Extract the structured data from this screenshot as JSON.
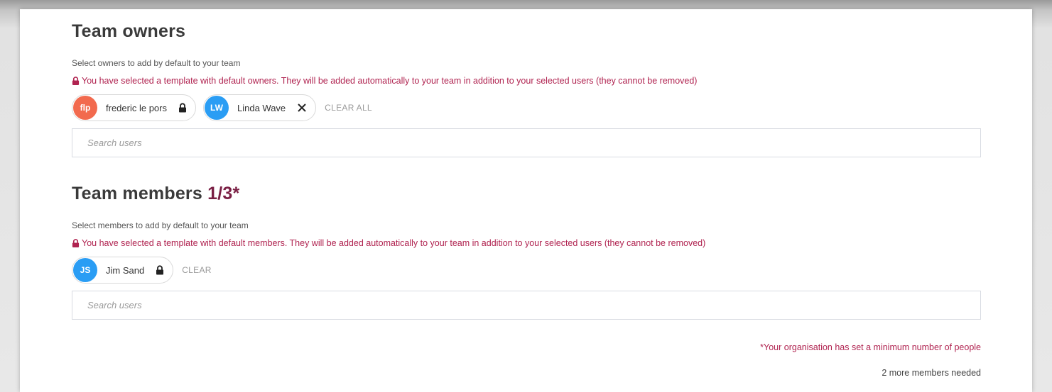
{
  "owners": {
    "title": "Team owners",
    "hint": "Select owners to add by default to your team",
    "warning": "You have selected a template with default owners. They will be added automatically to your team in addition to your selected users (they cannot be removed)",
    "chips": [
      {
        "initials": "flp",
        "name": "frederic le pors",
        "color": "#f26a4e",
        "action": "lock-icon"
      },
      {
        "initials": "LW",
        "name": "Linda Wave",
        "color": "#2a9df4",
        "action": "close-icon"
      }
    ],
    "clear_label": "CLEAR ALL",
    "search_placeholder": "Search users"
  },
  "members": {
    "title": "Team members",
    "count": "1/3*",
    "hint": "Select members to add by default to your team",
    "warning": "You have selected a template with default members. They will be added automatically to your team in addition to your selected users (they cannot be removed)",
    "chips": [
      {
        "initials": "JS",
        "name": "Jim Sand",
        "color": "#2a9df4",
        "action": "lock-icon"
      }
    ],
    "clear_label": "CLEAR",
    "search_placeholder": "Search users"
  },
  "footer": {
    "minimum_note": "*Your organisation has set a minimum number of people",
    "needed_note": "2 more members needed"
  },
  "colors": {
    "accent": "#7a1f44",
    "warning": "#b02350"
  }
}
